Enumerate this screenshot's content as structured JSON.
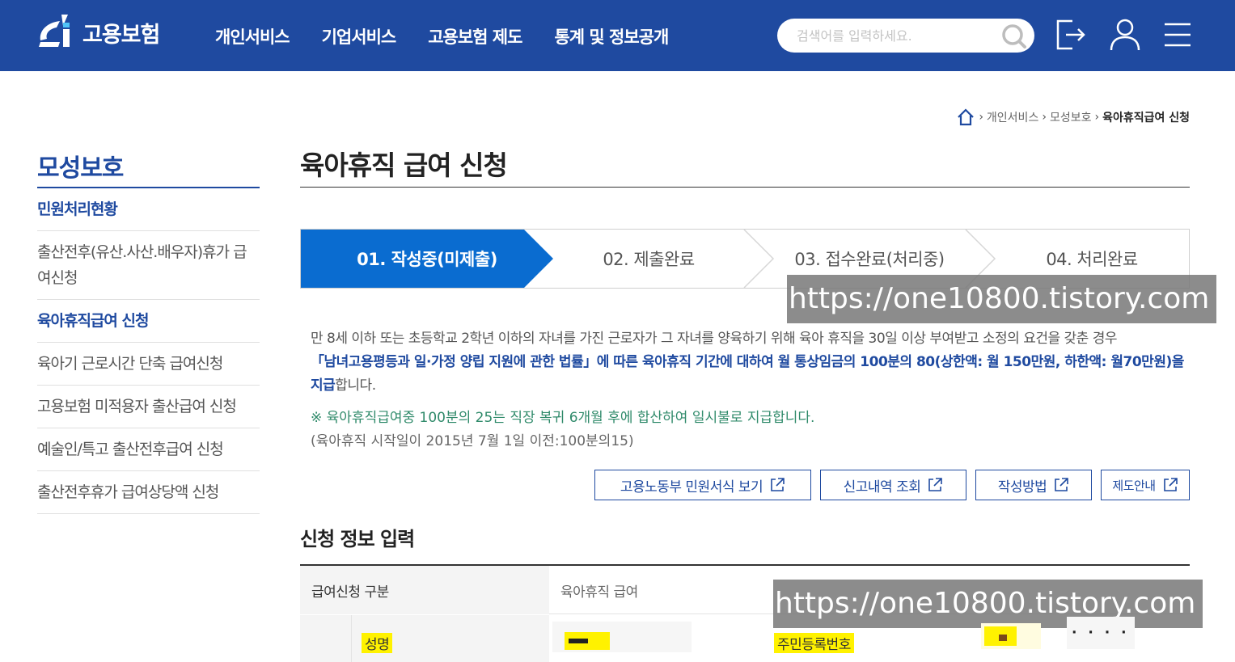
{
  "header": {
    "logo_text": "고용보험",
    "nav": [
      "개인서비스",
      "기업서비스",
      "고용보험 제도",
      "통계 및 정보공개"
    ],
    "search_placeholder": "검색어를 입력하세요."
  },
  "breadcrumb": {
    "items": [
      "개인서비스",
      "모성보호"
    ],
    "current": "육아휴직급여 신청"
  },
  "sidebar": {
    "title": "모성보호",
    "items": [
      {
        "label": "민원처리현황",
        "active": true
      },
      {
        "label": "출산전후(유산.사산.배우자)휴가 급\n여신청",
        "active": false
      },
      {
        "label": "육아휴직급여 신청",
        "active": true
      },
      {
        "label": "육아기 근로시간 단축 급여신청",
        "active": false
      },
      {
        "label": "고용보험 미적용자 출산급여 신청",
        "active": false
      },
      {
        "label": "예술인/특고 출산전후급여 신청",
        "active": false
      },
      {
        "label": "출산전후휴가 급여상당액 신청",
        "active": false
      }
    ]
  },
  "main": {
    "title": "육아휴직 급여 신청",
    "steps": [
      "01. 작성중(미제출)",
      "02. 제출완료",
      "03. 접수완료(처리중)",
      "04. 처리완료"
    ],
    "desc_plain1": "만 8세 이하 또는 초등학교 2학년 이하의 자녀를 가진 근로자가 그 자녀를 양육하기 위해 육아 휴직을 30일 이상 부여받고 소정의 요건을 갖춘 경우",
    "desc_blue": "「남녀고용평등과 일·가정 양립 지원에 관한 법률」에 따른 육아휴직 기간에 대하여 월 통상임금의 100분의 80(상한액: 월 150만원, 하한액: 월70만원)을 지급",
    "desc_plain2": "합니다.",
    "note1": "※ 육아휴직급여중 100분의 25는 직장 복귀 6개월 후에 합산하여 일시불로 지급합니다.",
    "note2": "(육아휴직 시작일이 2015년 7월 1일 이전:100분의15)",
    "buttons": [
      "고용노동부 민원서식 보기",
      "신고내역 조회",
      "작성방법",
      "제도안내"
    ],
    "section_title": "신청 정보 입력",
    "form": {
      "type_label": "급여신청 구분",
      "type_value": "육아휴직 급여",
      "name_label": "성명",
      "rrn_label": "주민등록번호",
      "rrn_dots": "· · · ·"
    }
  },
  "watermark": "https://one10800.tistory.com",
  "colors": {
    "brand": "#1f4aa0",
    "active_step": "#0a6cd0",
    "highlight": "#fff200"
  }
}
